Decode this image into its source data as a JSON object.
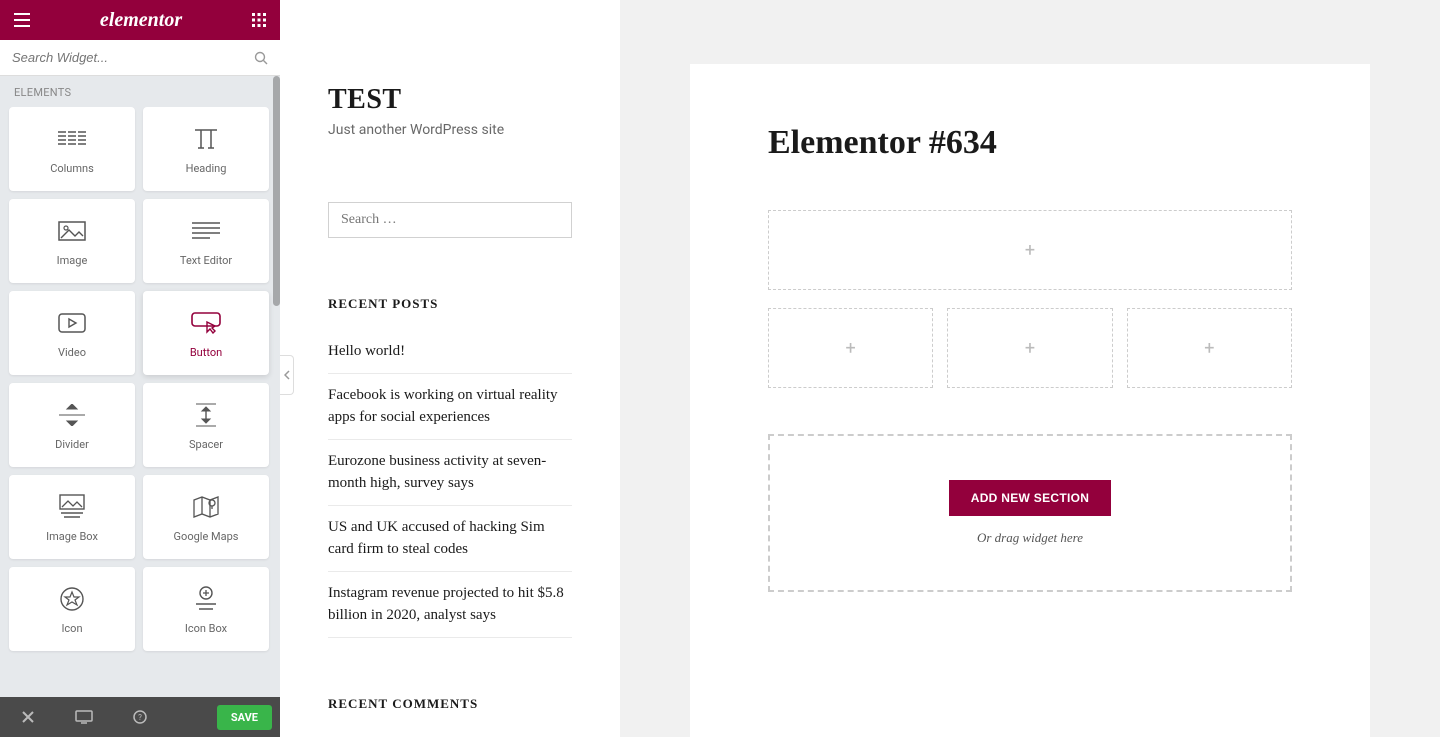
{
  "brand": "elementor",
  "search": {
    "placeholder": "Search Widget..."
  },
  "elements_label": "ELEMENTS",
  "widgets": [
    {
      "id": "columns",
      "label": "Columns"
    },
    {
      "id": "heading",
      "label": "Heading"
    },
    {
      "id": "image",
      "label": "Image"
    },
    {
      "id": "text-editor",
      "label": "Text Editor"
    },
    {
      "id": "video",
      "label": "Video"
    },
    {
      "id": "button",
      "label": "Button",
      "active": true
    },
    {
      "id": "divider",
      "label": "Divider"
    },
    {
      "id": "spacer",
      "label": "Spacer"
    },
    {
      "id": "image-box",
      "label": "Image Box"
    },
    {
      "id": "google-maps",
      "label": "Google Maps"
    },
    {
      "id": "icon",
      "label": "Icon"
    },
    {
      "id": "icon-box",
      "label": "Icon Box"
    }
  ],
  "footer": {
    "save": "SAVE"
  },
  "wp": {
    "site_title": "TEST",
    "tagline": "Just another WordPress site",
    "search_placeholder": "Search …",
    "recent_posts_heading": "RECENT POSTS",
    "posts": [
      "Hello world!",
      "Facebook is working on virtual reality apps for social experiences",
      "Eurozone business activity at seven-month high, survey says",
      "US and UK accused of hacking Sim card firm to steal codes",
      "Instagram revenue projected to hit $5.8 billion in 2020, analyst says"
    ],
    "recent_comments_heading": "RECENT COMMENTS"
  },
  "canvas": {
    "page_title": "Elementor #634",
    "add_section_label": "ADD NEW SECTION",
    "drag_hint": "Or drag widget here"
  }
}
